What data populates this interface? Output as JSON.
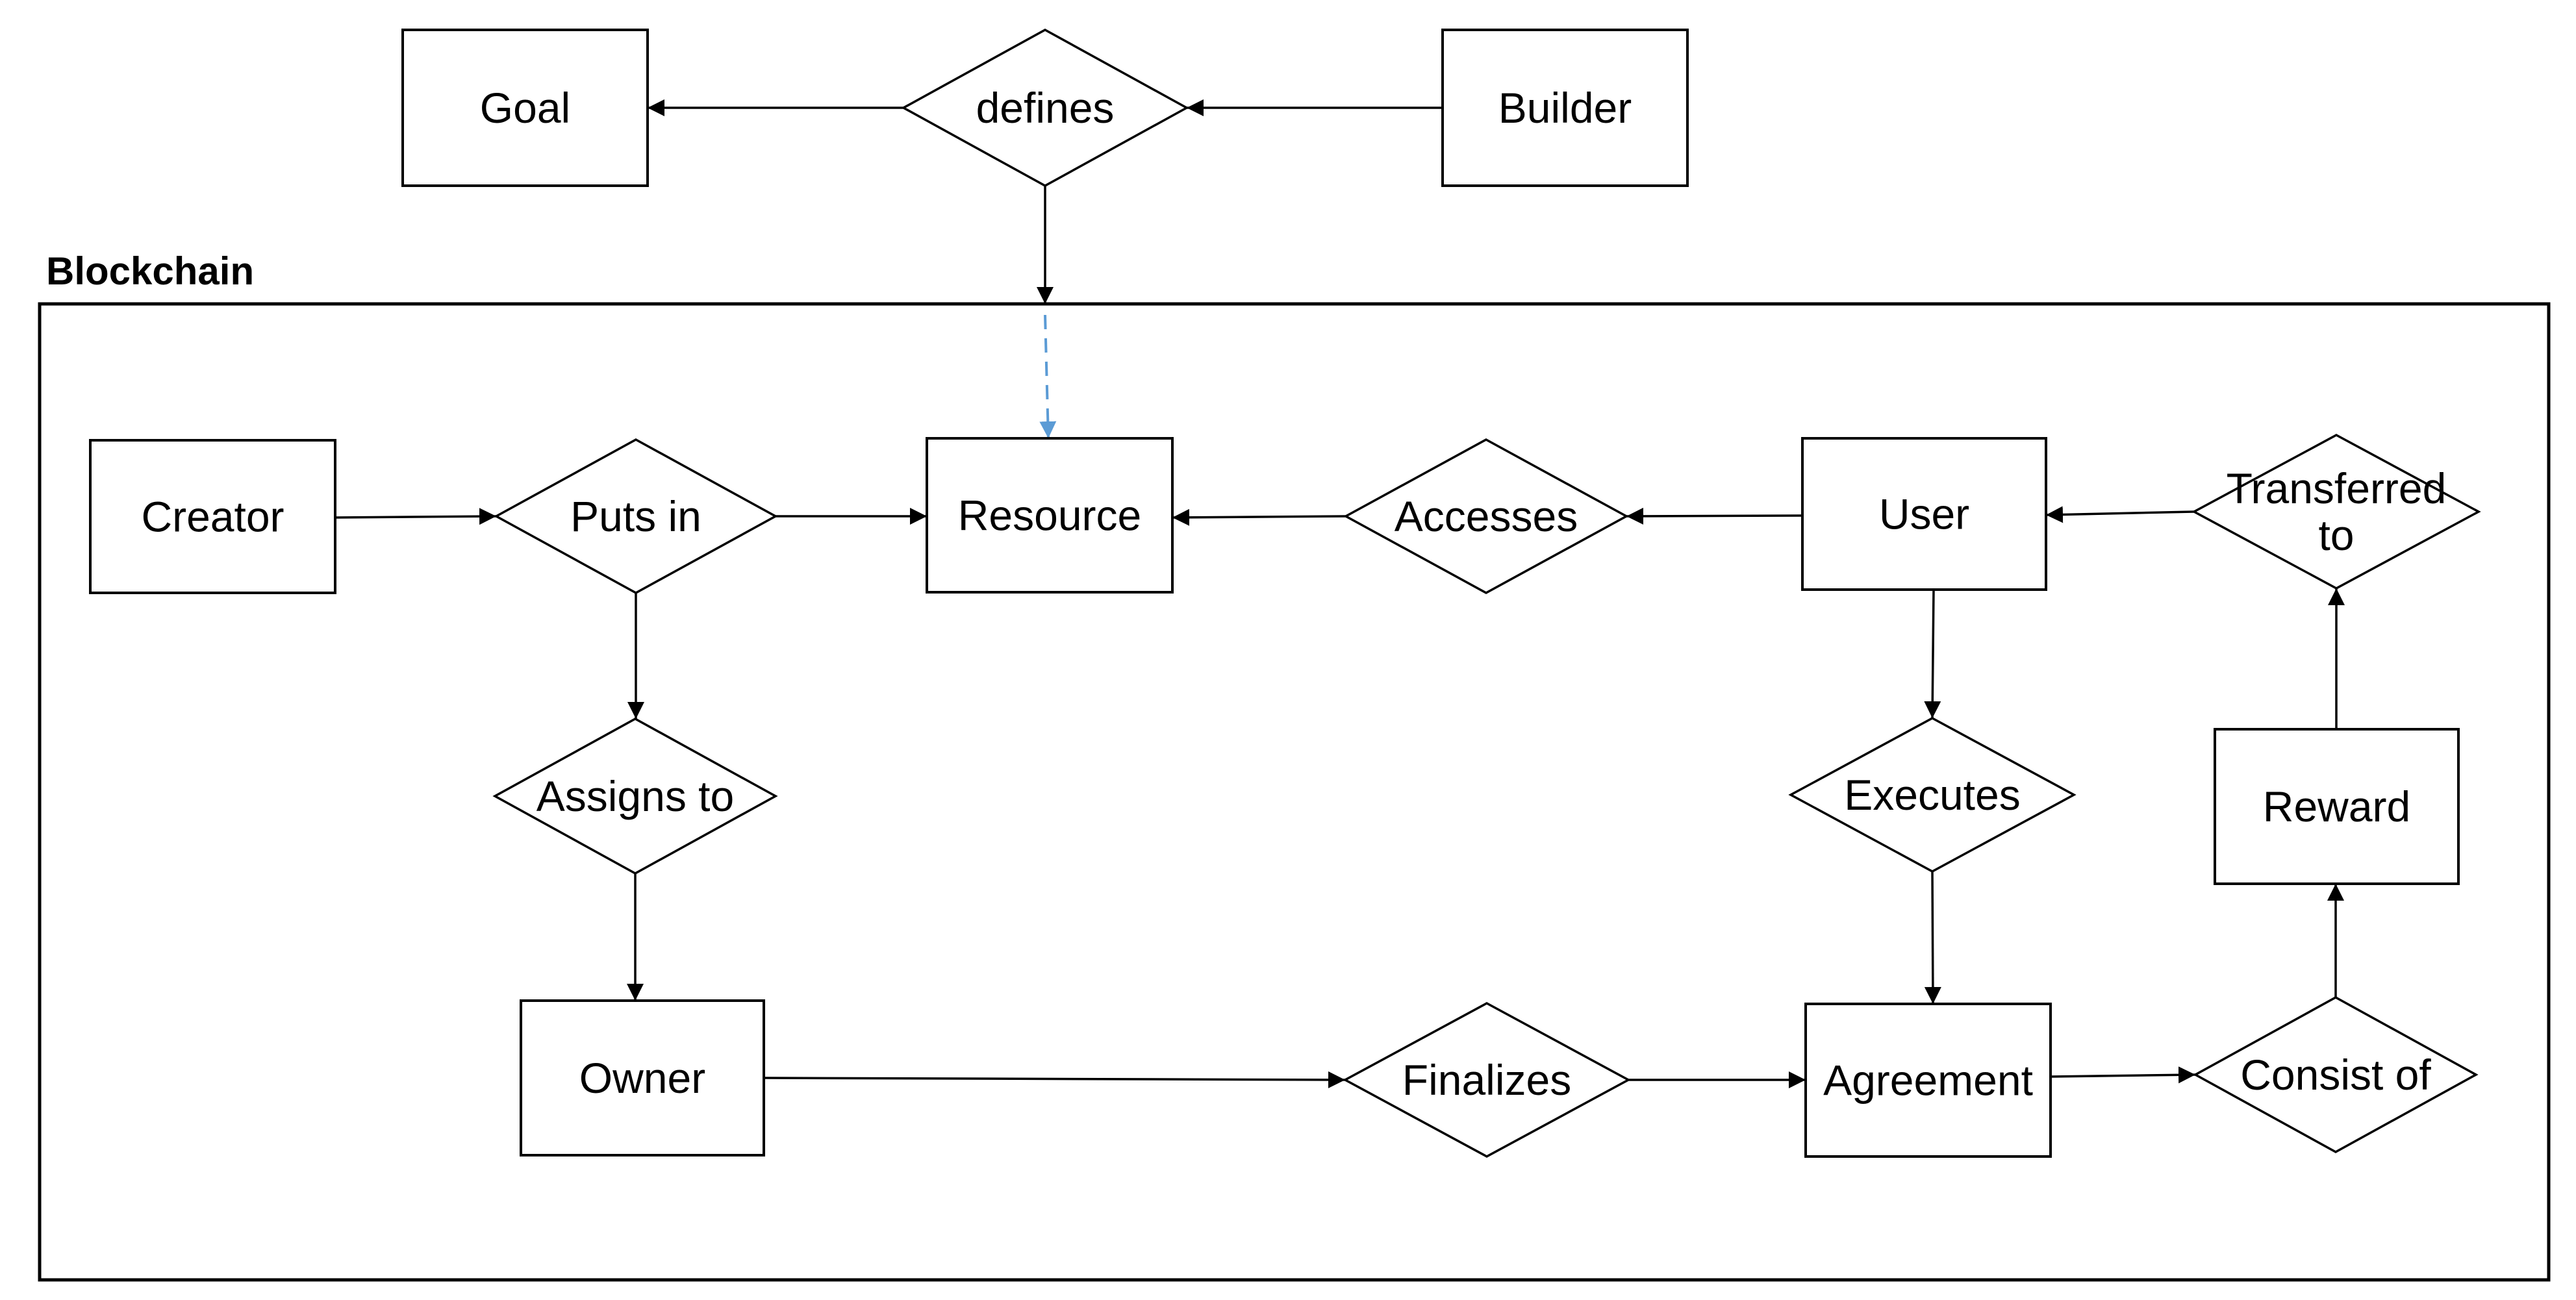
{
  "diagram": {
    "type": "entity-relationship",
    "container": {
      "label": "Blockchain"
    },
    "entities": [
      {
        "id": "goal",
        "label": "Goal",
        "shape": "rectangle"
      },
      {
        "id": "builder",
        "label": "Builder",
        "shape": "rectangle"
      },
      {
        "id": "creator",
        "label": "Creator",
        "shape": "rectangle"
      },
      {
        "id": "resource",
        "label": "Resource",
        "shape": "rectangle"
      },
      {
        "id": "user",
        "label": "User",
        "shape": "rectangle"
      },
      {
        "id": "reward",
        "label": "Reward",
        "shape": "rectangle"
      },
      {
        "id": "owner",
        "label": "Owner",
        "shape": "rectangle"
      },
      {
        "id": "agreement",
        "label": "Agreement",
        "shape": "rectangle"
      }
    ],
    "relationships": [
      {
        "id": "defines",
        "label": "defines",
        "shape": "diamond"
      },
      {
        "id": "puts_in",
        "label": "Puts in",
        "shape": "diamond"
      },
      {
        "id": "accesses",
        "label": "Accesses",
        "shape": "diamond"
      },
      {
        "id": "transferred_to",
        "label": "Transferred to",
        "lines": [
          "Transferred",
          "to"
        ],
        "shape": "diamond"
      },
      {
        "id": "assigns_to",
        "label": "Assigns to",
        "shape": "diamond"
      },
      {
        "id": "executes",
        "label": "Executes",
        "shape": "diamond"
      },
      {
        "id": "finalizes",
        "label": "Finalizes",
        "shape": "diamond"
      },
      {
        "id": "consist_of",
        "label": "Consist of",
        "shape": "diamond"
      }
    ],
    "edges": [
      {
        "from": "builder",
        "to": "defines",
        "style": "solid"
      },
      {
        "from": "defines",
        "to": "goal",
        "style": "solid"
      },
      {
        "from": "defines",
        "to": "blockchain",
        "style": "solid"
      },
      {
        "from": "blockchain",
        "to": "resource",
        "style": "dashed"
      },
      {
        "from": "creator",
        "to": "puts_in",
        "style": "solid"
      },
      {
        "from": "puts_in",
        "to": "resource",
        "style": "solid"
      },
      {
        "from": "puts_in",
        "to": "assigns_to",
        "style": "solid"
      },
      {
        "from": "assigns_to",
        "to": "owner",
        "style": "solid"
      },
      {
        "from": "user",
        "to": "accesses",
        "style": "solid"
      },
      {
        "from": "accesses",
        "to": "resource",
        "style": "solid"
      },
      {
        "from": "transferred_to",
        "to": "user",
        "style": "solid"
      },
      {
        "from": "user",
        "to": "executes",
        "style": "solid"
      },
      {
        "from": "executes",
        "to": "agreement",
        "style": "solid"
      },
      {
        "from": "owner",
        "to": "finalizes",
        "style": "solid"
      },
      {
        "from": "finalizes",
        "to": "agreement",
        "style": "solid"
      },
      {
        "from": "agreement",
        "to": "consist_of",
        "style": "solid"
      },
      {
        "from": "consist_of",
        "to": "reward",
        "style": "solid"
      },
      {
        "from": "reward",
        "to": "transferred_to",
        "style": "solid"
      }
    ],
    "colors": {
      "stroke": "#000000",
      "fill": "#ffffff",
      "dashed_edge": "#5B9BD5"
    }
  }
}
